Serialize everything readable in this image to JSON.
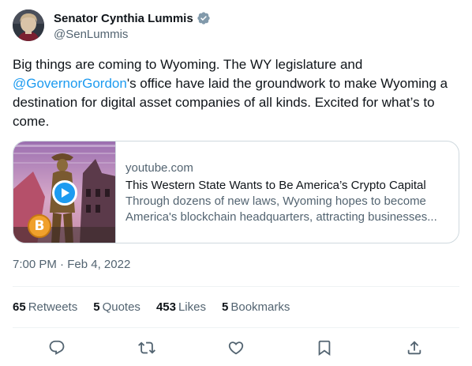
{
  "author": {
    "display_name": "Senator Cynthia Lummis",
    "handle": "@SenLummis",
    "verified_icon": "verified-badge-icon",
    "verified_color": "#829aab"
  },
  "tweet": {
    "text_before": "Big things are coming to Wyoming. The WY legislature and ",
    "mention": "@GovernorGordon",
    "text_after": "'s office have laid the groundwork to make Wyoming a destination for digital asset companies of all kinds. Excited for what’s to come."
  },
  "card": {
    "domain": "youtube.com",
    "title": "This Western State Wants to Be America’s Crypto Capital",
    "description": "Through dozens of new laws, Wyoming hopes to become America's blockchain headquarters, attracting businesses...",
    "play_icon": "play-icon",
    "coin_icon": "bitcoin-coin-icon",
    "coin_symbol": "B"
  },
  "timestamp": {
    "time": "7:00 PM",
    "separator": " · ",
    "date": "Feb 4, 2022"
  },
  "stats": [
    {
      "count": "65",
      "label": "Retweets"
    },
    {
      "count": "5",
      "label": "Quotes"
    },
    {
      "count": "453",
      "label": "Likes"
    },
    {
      "count": "5",
      "label": "Bookmarks"
    }
  ],
  "actions": {
    "reply": "reply-icon",
    "retweet": "retweet-icon",
    "like": "heart-icon",
    "bookmark": "bookmark-icon",
    "share": "share-icon"
  },
  "colors": {
    "link": "#1d9bf0",
    "secondary_text": "#536471",
    "primary_text": "#0f1419",
    "border": "#cfd9de"
  }
}
